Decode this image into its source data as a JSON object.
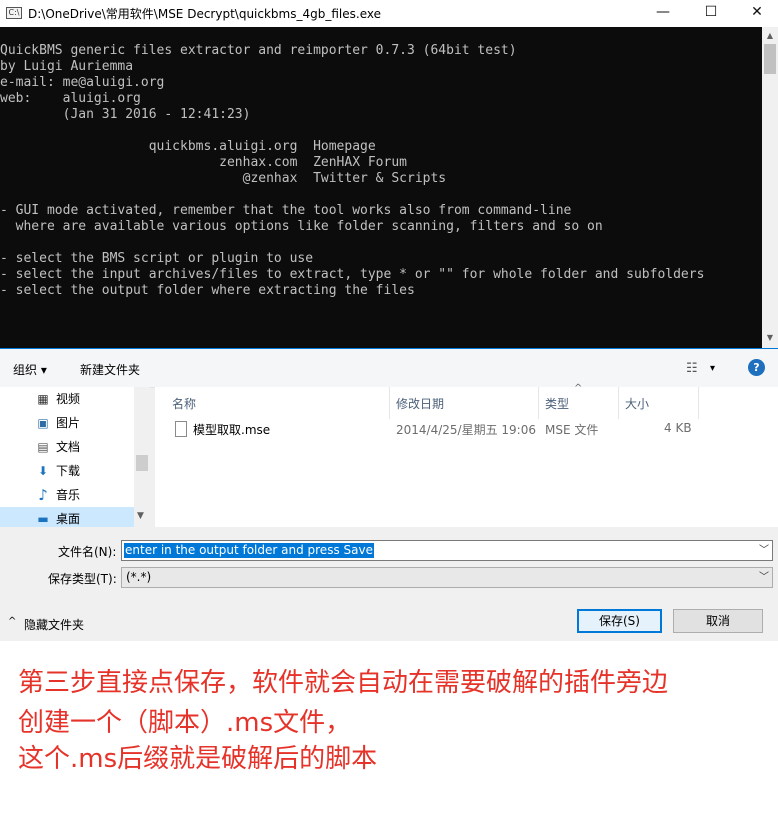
{
  "window": {
    "title": "D:\\OneDrive\\常用软件\\MSE Decrypt\\quickbms_4gb_files.exe",
    "minimize_glyph": "—",
    "maximize_glyph": "☐",
    "close_glyph": "✕"
  },
  "console": {
    "text": "QuickBMS generic files extractor and reimporter 0.7.3 (64bit test)\nby Luigi Auriemma\ne-mail: me@aluigi.org\nweb:    aluigi.org\n        (Jan 31 2016 - 12:41:23)\n\n                   quickbms.aluigi.org  Homepage\n                            zenhax.com  ZenHAX Forum\n                               @zenhax  Twitter & Scripts\n\n- GUI mode activated, remember that the tool works also from command-line\n  where are available various options like folder scanning, filters and so on\n\n- select the BMS script or plugin to use\n- select the input archives/files to extract, type * or \"\" for whole folder and subfolders\n- select the output folder where extracting the files"
  },
  "toolbar": {
    "organize": "组织 ▾",
    "new_folder": "新建文件夹",
    "view_icon": "view-options-icon",
    "view_arrow": "▾",
    "help": "?"
  },
  "nav": {
    "items": [
      {
        "label": "视频",
        "icon": "video-icon",
        "glyph": "▦"
      },
      {
        "label": "图片",
        "icon": "picture-icon",
        "glyph": "▣"
      },
      {
        "label": "文档",
        "icon": "document-icon",
        "glyph": "▤"
      },
      {
        "label": "下载",
        "icon": "download-icon",
        "glyph": "⬇"
      },
      {
        "label": "音乐",
        "icon": "music-icon",
        "glyph": "♪"
      },
      {
        "label": "桌面",
        "icon": "desktop-icon",
        "glyph": "▬"
      }
    ],
    "selected_index": 5
  },
  "files": {
    "columns": [
      "名称",
      "修改日期",
      "类型",
      "大小"
    ],
    "rows": [
      {
        "name": "模型取取.mse",
        "date": "2014/4/25/星期五 19:06",
        "type": "MSE 文件",
        "size": "4 KB"
      }
    ]
  },
  "form": {
    "filename_label": "文件名(N):",
    "filename_value": "enter in the output folder and press Save",
    "filetype_label": "保存类型(T):",
    "filetype_value": "(*.*)",
    "hide_folders": "隐藏文件夹",
    "save": "保存(S)",
    "cancel": "取消"
  },
  "annotation": {
    "lines": [
      "第三步直接点保存，软件就会自动在需要破解的插件旁边",
      "创建一个（脚本）.ms文件，",
      "这个.ms后缀就是破解后的脚本"
    ],
    "color": "#e6332a"
  }
}
